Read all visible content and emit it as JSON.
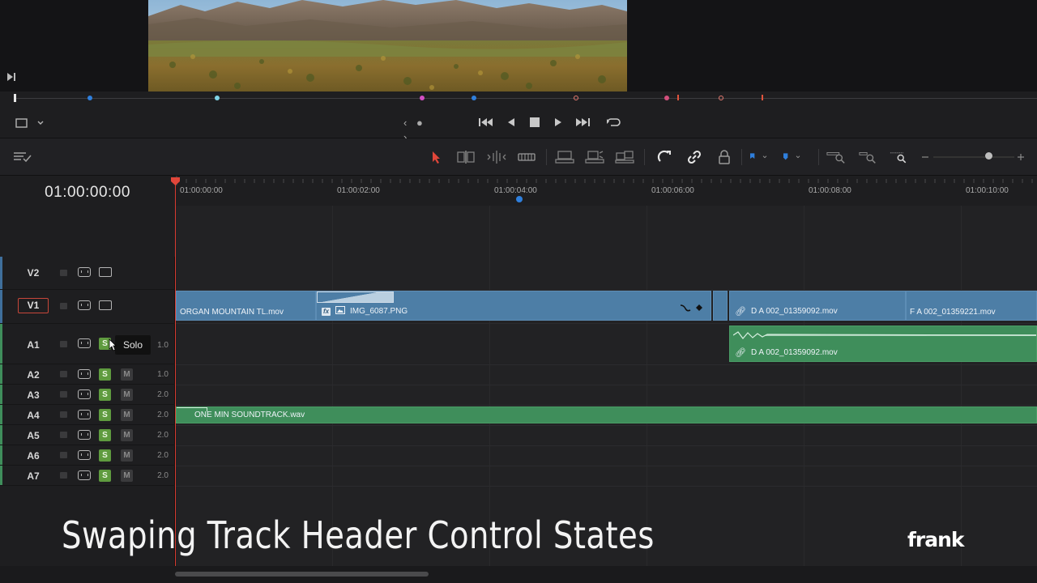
{
  "viewer": {
    "image_subject": "desert mountain landscape"
  },
  "transport": {
    "jog_glyph": "‹ ● ›"
  },
  "timeline": {
    "timecode": "01:00:00:00",
    "ruler_labels": [
      "01:00:00:00",
      "01:00:02:00",
      "01:00:04:00",
      "01:00:06:00",
      "01:00:08:00",
      "01:00:10:00"
    ]
  },
  "tracks": {
    "video": [
      {
        "name": "V2"
      },
      {
        "name": "V1"
      }
    ],
    "audio": [
      {
        "name": "A1",
        "volume": "1.0",
        "solo": "S",
        "mute": "M"
      },
      {
        "name": "A2",
        "volume": "1.0",
        "solo": "S",
        "mute": "M"
      },
      {
        "name": "A3",
        "volume": "2.0",
        "solo": "S",
        "mute": "M"
      },
      {
        "name": "A4",
        "volume": "2.0",
        "solo": "S",
        "mute": "M"
      },
      {
        "name": "A5",
        "volume": "2.0",
        "solo": "S",
        "mute": "M"
      },
      {
        "name": "A6",
        "volume": "2.0",
        "solo": "S",
        "mute": "M"
      },
      {
        "name": "A7",
        "volume": "2.0",
        "solo": "S",
        "mute": "M"
      }
    ]
  },
  "tooltip": {
    "text": "Solo"
  },
  "clips": {
    "v1_organ": "ORGAN MOUNTAIN TL.mov",
    "v1_img": "IMG_6087.PNG",
    "v1_img_fx": "fx",
    "v1_d": "D A 002_01359092.mov",
    "v1_f": "F A 002_01359221.mov",
    "a1_d": "D A 002_01359092.mov",
    "a4_soundtrack": "ONE MIN SOUNDTRACK.wav"
  },
  "overlay": {
    "caption": "Swaping Track Header Control States",
    "brand": "frank"
  },
  "colors": {
    "video_clip": "#4d7ea6",
    "audio_clip": "#3f8e5b",
    "playhead": "#d83a2f",
    "solo_active": "#5f9b3f",
    "marker_blue": "#2f7fdc"
  }
}
